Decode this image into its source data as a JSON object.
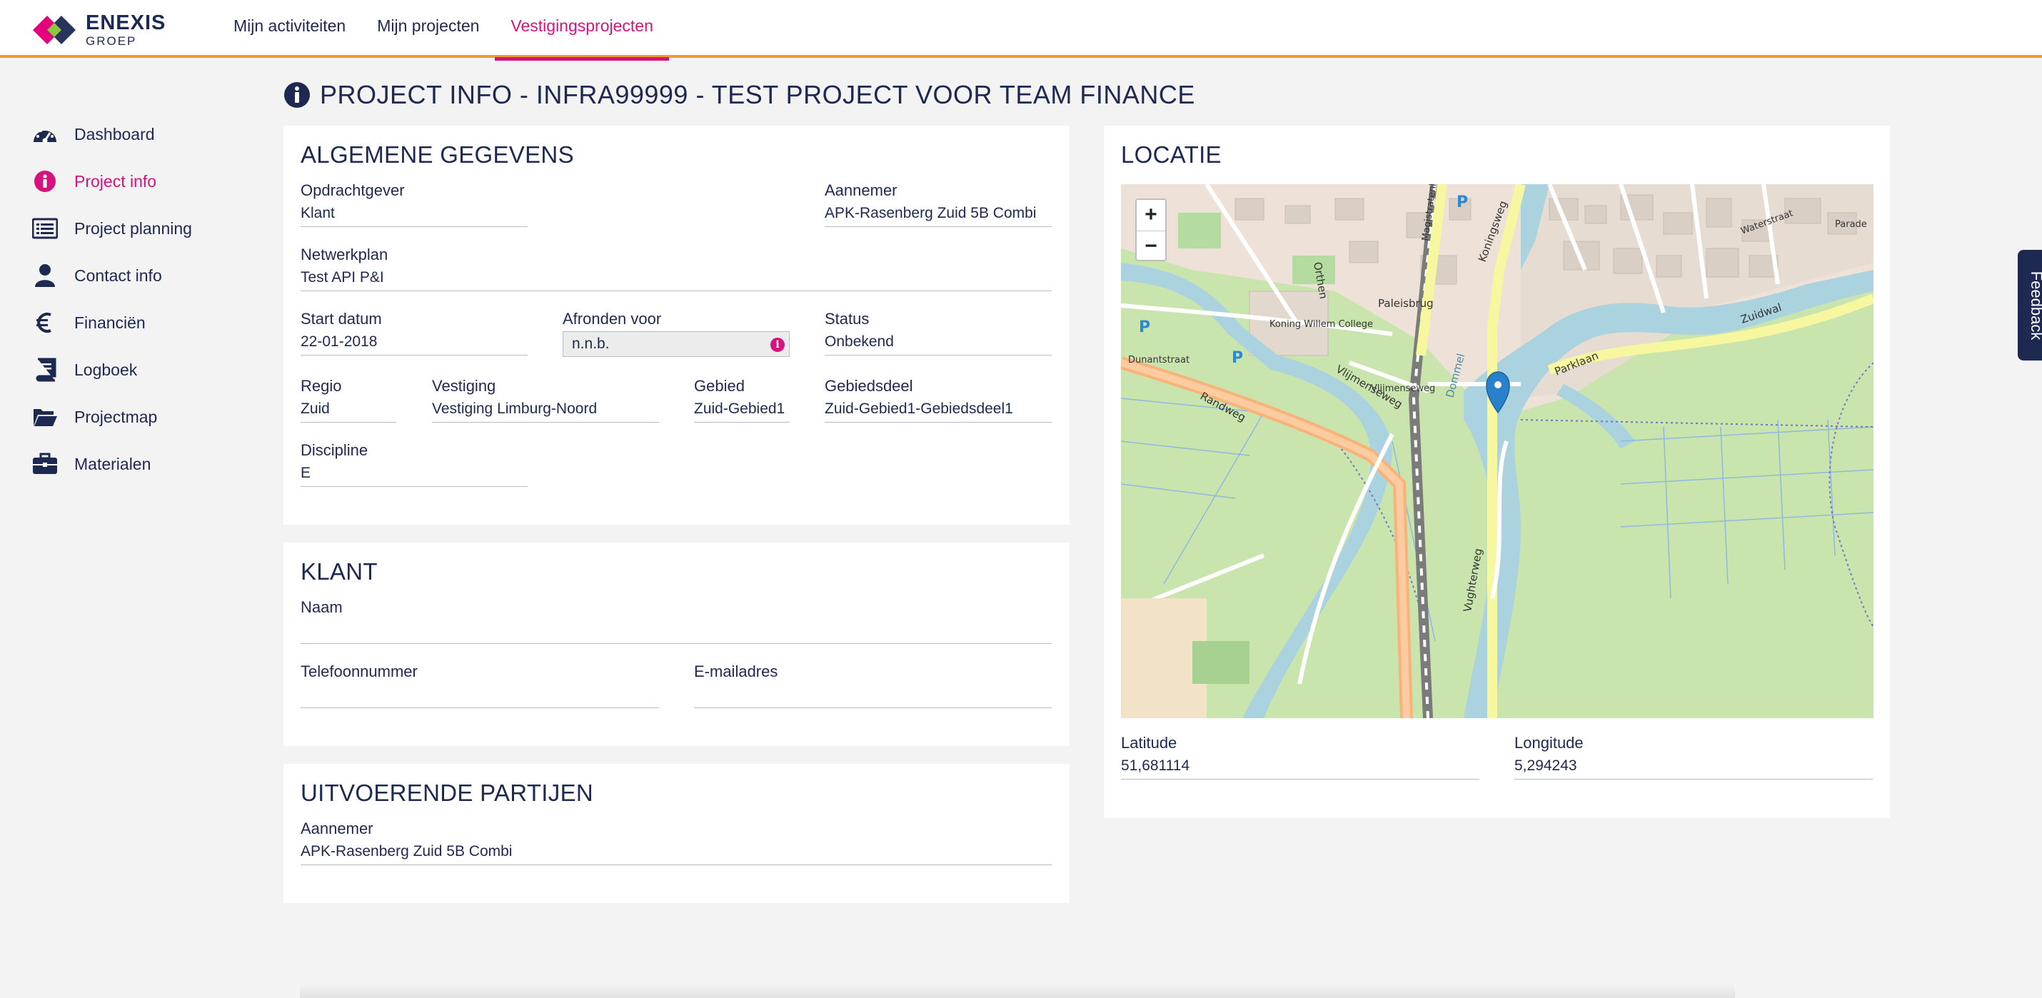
{
  "header": {
    "logo_name": "ENEXIS",
    "logo_sub": "GROEP",
    "nav": [
      {
        "label": "Mijn activiteiten"
      },
      {
        "label": "Mijn projecten"
      },
      {
        "label": "Vestigingsprojecten",
        "active": true
      }
    ]
  },
  "sidebar": {
    "items": [
      {
        "label": "Dashboard",
        "icon": "dashboard-icon"
      },
      {
        "label": "Project info",
        "icon": "info-icon",
        "active": true
      },
      {
        "label": "Project planning",
        "icon": "list-icon"
      },
      {
        "label": "Contact info",
        "icon": "user-icon"
      },
      {
        "label": "Financiën",
        "icon": "euro-icon"
      },
      {
        "label": "Logboek",
        "icon": "book-icon"
      },
      {
        "label": "Projectmap",
        "icon": "folder-open-icon"
      },
      {
        "label": "Materialen",
        "icon": "briefcase-icon"
      }
    ]
  },
  "page": {
    "title": "PROJECT INFO - INFRA99999 - TEST PROJECT VOOR TEAM FINANCE"
  },
  "algemeen": {
    "title": "ALGEMENE GEGEVENS",
    "opdrachtgever": {
      "label": "Opdrachtgever",
      "value": "Klant"
    },
    "aannemer": {
      "label": "Aannemer",
      "value": "APK-Rasenberg Zuid 5B Combi"
    },
    "netwerkplan": {
      "label": "Netwerkplan",
      "value": "Test API P&I"
    },
    "start_datum": {
      "label": "Start datum",
      "value": "22-01-2018"
    },
    "afronden_voor": {
      "label": "Afronden voor",
      "value": "n.n.b."
    },
    "status": {
      "label": "Status",
      "value": "Onbekend"
    },
    "regio": {
      "label": "Regio",
      "value": "Zuid"
    },
    "vestiging": {
      "label": "Vestiging",
      "value": "Vestiging Limburg-Noord"
    },
    "gebied": {
      "label": "Gebied",
      "value": "Zuid-Gebied1"
    },
    "gebiedsdeel": {
      "label": "Gebiedsdeel",
      "value": "Zuid-Gebied1-Gebiedsdeel1"
    },
    "discipline": {
      "label": "Discipline",
      "value": "E"
    }
  },
  "klant": {
    "title": "KLANT",
    "naam": {
      "label": "Naam",
      "value": ""
    },
    "telefoon": {
      "label": "Telefoonnummer",
      "value": ""
    },
    "email": {
      "label": "E-mailadres",
      "value": ""
    }
  },
  "partijen": {
    "title": "UITVOERENDE PARTIJEN",
    "aannemer": {
      "label": "Aannemer",
      "value": "APK-Rasenberg Zuid 5B Combi"
    }
  },
  "locatie": {
    "title": "LOCATIE",
    "latitude": {
      "label": "Latitude",
      "value": "51,681114"
    },
    "longitude": {
      "label": "Longitude",
      "value": "5,294243"
    },
    "zoom_in": "+",
    "zoom_out": "−",
    "map_labels": [
      "Paleisbrug",
      "Parklaan",
      "Zuidwal",
      "Randweg",
      "Vlijmenseweg",
      "Vughterweg",
      "Koning Willem College",
      "Dommel",
      "Orthen",
      "Waterstraat",
      "Parade",
      "Koningsweg",
      "Magistratenlaan",
      "Vlijmenseweg",
      "Dunantstraat",
      "P",
      "P",
      "P"
    ]
  },
  "feedback": "Feedback",
  "colors": {
    "brand_navy": "#1d2951",
    "accent_pink": "#d4137f",
    "accent_orange": "#f39a2d"
  }
}
